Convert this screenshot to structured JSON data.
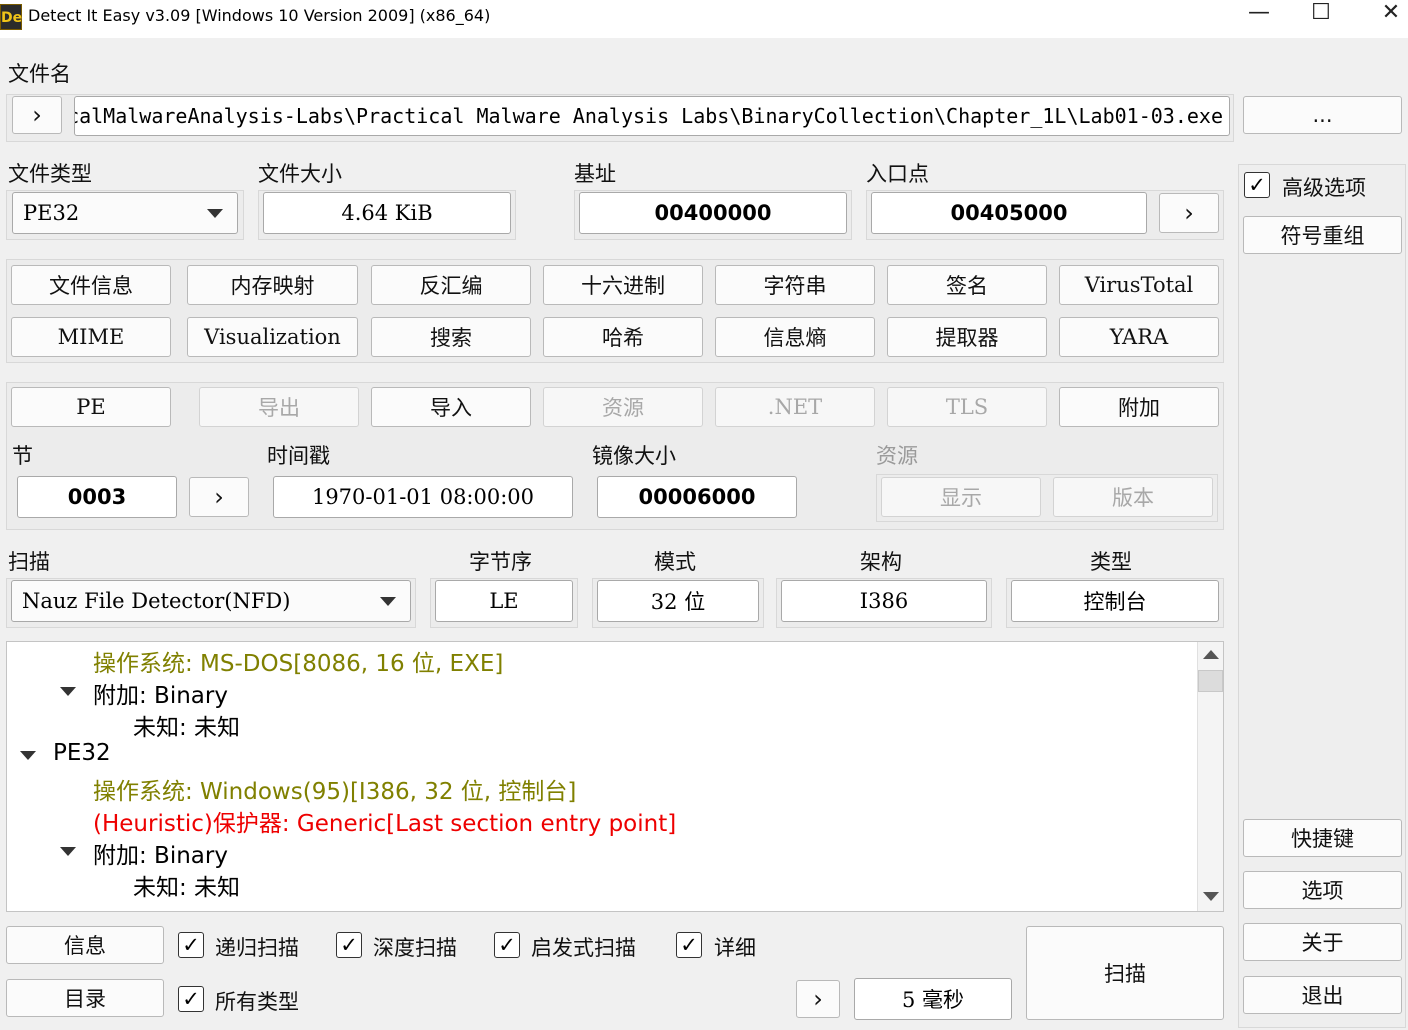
{
  "window": {
    "title": "Detect It Easy v3.09 [Windows 10 Version 2009] (x86_64)",
    "icon_text": "De",
    "minimize": "—",
    "maximize": "☐",
    "close": "✕"
  },
  "file": {
    "label": "文件名",
    "expand": "›",
    "path": "calMalwareAnalysis-Labs\\Practical Malware Analysis Labs\\BinaryCollection\\Chapter_1L\\Lab01-03.exe",
    "browse": "..."
  },
  "info": {
    "file_type_label": "文件类型",
    "file_type": "PE32",
    "file_size_label": "文件大小",
    "file_size": "4.64 KiB",
    "base_label": "基址",
    "base": "00400000",
    "entry_label": "入口点",
    "entry": "00405000",
    "entry_go": "›"
  },
  "tools_row1": [
    "文件信息",
    "内存映射",
    "反汇编",
    "十六进制",
    "字符串",
    "签名",
    "VirusTotal"
  ],
  "tools_row2": [
    "MIME",
    "Visualization",
    "搜索",
    "哈希",
    "信息熵",
    "提取器",
    "YARA"
  ],
  "pe_row": {
    "pe": "PE",
    "export": "导出",
    "import": "导入",
    "resources": "资源",
    "net": ".NET",
    "tls": "TLS",
    "overlay": "附加"
  },
  "pe_info": {
    "section_label": "节",
    "section": "0003",
    "section_go": "›",
    "timestamp_label": "时间戳",
    "timestamp": "1970-01-01 08:00:00",
    "image_size_label": "镜像大小",
    "image_size": "00006000",
    "res_label": "资源",
    "res_show": "显示",
    "res_version": "版本"
  },
  "scan": {
    "scan_label": "扫描",
    "engine": "Nauz File Detector(NFD)",
    "endian_label": "字节序",
    "endian": "LE",
    "mode_label": "模式",
    "mode": "32 位",
    "arch_label": "架构",
    "arch": "I386",
    "type_label": "类型",
    "type": "控制台"
  },
  "results": {
    "l1": "操作系统: MS-DOS[8086, 16 位, EXE]",
    "l2": "附加: Binary",
    "l3": "未知: 未知",
    "l4": "PE32",
    "l5": "操作系统: Windows(95)[I386, 32 位, 控制台]",
    "l6": "(Heuristic)保护器: Generic[Last section entry point]",
    "l7": "附加: Binary",
    "l8": "未知: 未知"
  },
  "bottom": {
    "info_btn": "信息",
    "dir_btn": "目录",
    "recursive": "递归扫描",
    "deep": "深度扫描",
    "heuristic": "启发式扫描",
    "verbose": "详细",
    "all_types": "所有类型",
    "next": "›",
    "time": "5 毫秒",
    "scan_btn": "扫描",
    "check_mark": "✓"
  },
  "sidebar": {
    "advanced": "高级选项",
    "demangle": "符号重组",
    "shortcuts": "快捷键",
    "options": "选项",
    "about": "关于",
    "exit": "退出"
  }
}
